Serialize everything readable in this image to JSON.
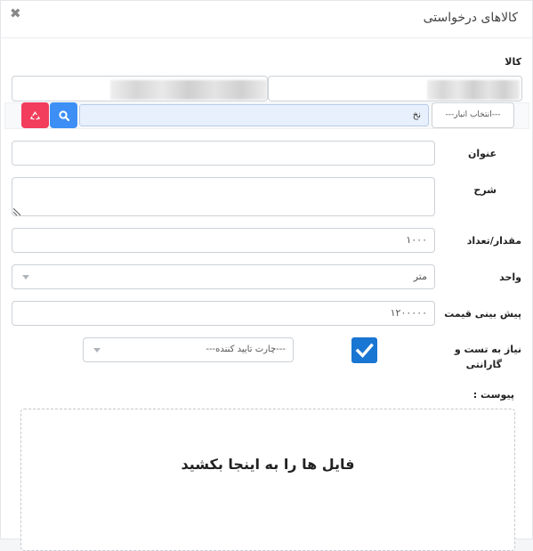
{
  "modal": {
    "title": "کالاهای درخواستی",
    "close": "✖"
  },
  "form": {
    "kala_label": "کالا",
    "warehouse_placeholder": "---انتخاب انبار---",
    "warehouse_search_value": "نخ",
    "search_icon": "search-icon",
    "recycle_icon": "recycle-icon",
    "title_label": "عنوان",
    "title_value": "",
    "description_label": "شرح",
    "description_value": "",
    "quantity_label": "مقدار/تعداد",
    "quantity_value": "۱۰۰۰",
    "unit_label": "واحد",
    "unit_value": "متر",
    "price_label": "پیش بینی قیمت",
    "price_value": "۱۲۰۰۰۰۰",
    "test_label_line1": "نیاز به تست و",
    "test_label_line2": "گارانتی",
    "test_checked": true,
    "chart_placeholder": "---چارت تایید کننده---",
    "attachment_label": "پیوست :",
    "dropzone_text": "فایل ها را به اینجا بکشید"
  },
  "colors": {
    "primary": "#3d8ff5",
    "danger": "#f23d5c",
    "checkbox": "#1976d2"
  }
}
